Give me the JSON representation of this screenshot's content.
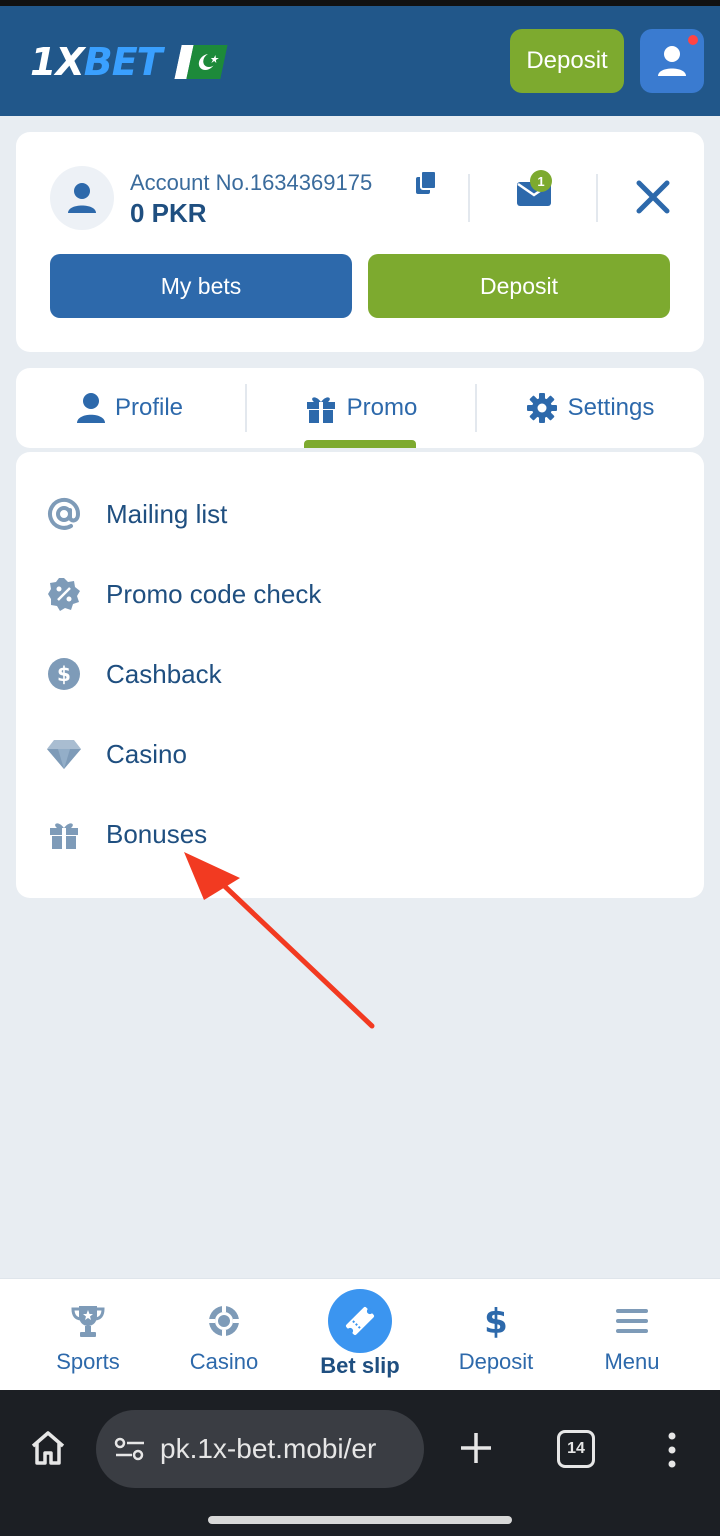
{
  "header": {
    "logo_main": "1X",
    "logo_accent": "BET",
    "deposit_label": "Deposit",
    "user_icon": "user-icon",
    "country_flag": "pakistan-flag"
  },
  "account": {
    "account_label": "Account No.1634369175",
    "balance": "0 PKR",
    "mail_badge": "1",
    "my_bets_label": "My bets",
    "deposit_label": "Deposit"
  },
  "tabs": [
    {
      "label": "Profile",
      "icon": "person-icon"
    },
    {
      "label": "Promo",
      "icon": "gift-icon",
      "active": true
    },
    {
      "label": "Settings",
      "icon": "gear-icon"
    }
  ],
  "promo_menu": [
    {
      "label": "Mailing list",
      "icon": "at-sign-icon"
    },
    {
      "label": "Promo code check",
      "icon": "percent-badge-icon"
    },
    {
      "label": "Cashback",
      "icon": "dollar-circle-icon"
    },
    {
      "label": "Casino",
      "icon": "diamond-icon"
    },
    {
      "label": "Bonuses",
      "icon": "gift-icon"
    }
  ],
  "bottom_nav": [
    {
      "label": "Sports",
      "icon": "trophy-icon"
    },
    {
      "label": "Casino",
      "icon": "chip-icon"
    },
    {
      "label": "Bet slip",
      "icon": "ticket-icon",
      "active": true
    },
    {
      "label": "Deposit",
      "icon": "dollar-icon"
    },
    {
      "label": "Menu",
      "icon": "hamburger-icon"
    }
  ],
  "browser": {
    "url": "pk.1x-bet.mobi/er",
    "tab_count": "14"
  },
  "colors": {
    "header_bg": "#21578a",
    "accent_green": "#7daa2f",
    "primary_blue": "#2d69ab",
    "annotation_arrow": "#f23a21"
  }
}
